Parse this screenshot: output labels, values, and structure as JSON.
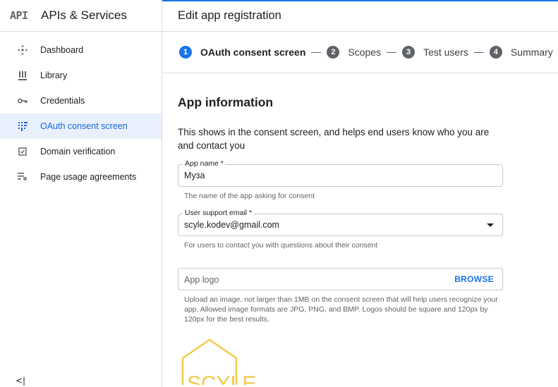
{
  "sidebar": {
    "logo": "API",
    "title": "APIs & Services",
    "items": [
      {
        "label": "Dashboard",
        "icon": "dashboard-icon"
      },
      {
        "label": "Library",
        "icon": "library-icon"
      },
      {
        "label": "Credentials",
        "icon": "key-icon"
      },
      {
        "label": "OAuth consent screen",
        "icon": "consent-icon"
      },
      {
        "label": "Domain verification",
        "icon": "checkbox-icon"
      },
      {
        "label": "Page usage agreements",
        "icon": "settings-list-icon"
      }
    ],
    "active_index": 3,
    "collapse_icon": "collapse-left-icon"
  },
  "header": {
    "title": "Edit app registration"
  },
  "stepper": {
    "steps": [
      {
        "num": "1",
        "label": "OAuth consent screen"
      },
      {
        "num": "2",
        "label": "Scopes"
      },
      {
        "num": "3",
        "label": "Test users"
      },
      {
        "num": "4",
        "label": "Summary"
      }
    ],
    "active_index": 0
  },
  "app_info": {
    "title": "App information",
    "description": "This shows in the consent screen, and helps end users know who you are and contact you"
  },
  "form": {
    "app_name": {
      "label": "App name *",
      "value": "Муза",
      "hint": "The name of the app asking for consent"
    },
    "support_email": {
      "label": "User support email *",
      "value": "scyle.kodev@gmail.com",
      "hint": "For users to contact you with questions about their consent"
    },
    "app_logo": {
      "placeholder": "App logo",
      "browse_label": "BROWSE",
      "hint": "Upload an image, not larger than 1MB on the consent screen that will help users recognize your app. Allowed image formats are JPG, PNG, and BMP. Logos should be square and 120px by 120px for the best results."
    },
    "logo_preview_text": "SCYLE"
  },
  "colors": {
    "accent": "#1a73e8",
    "active_bg": "#e8f0fe",
    "logo_gold": "#f2c94c"
  }
}
